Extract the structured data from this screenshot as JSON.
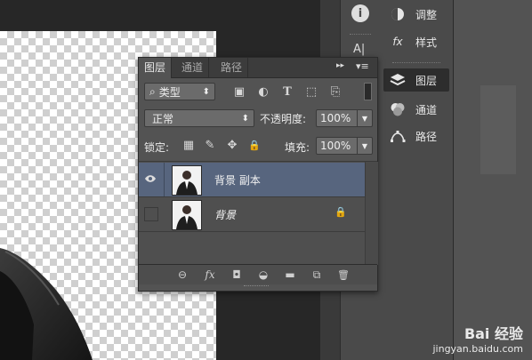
{
  "dock_left": {
    "icons": [
      "info-icon",
      "character-icon"
    ],
    "char_label": "A|"
  },
  "dock": {
    "items": [
      {
        "label": "调整",
        "icon": "adjustments-icon"
      },
      {
        "label": "样式",
        "icon": "styles-icon",
        "glyph": "fx"
      },
      {
        "label": "图层",
        "icon": "layers-icon"
      },
      {
        "label": "通道",
        "icon": "channels-icon"
      },
      {
        "label": "路径",
        "icon": "paths-icon"
      }
    ]
  },
  "layers_panel": {
    "tabs": [
      "图层",
      "通道",
      "路径"
    ],
    "menu_glyphs": {
      "collapse": "▸▸",
      "menu": "▾≡"
    },
    "filter": {
      "icon_glyph": "⌕",
      "label": "类型",
      "arrow": "⬍"
    },
    "filter_icon_glyphs": [
      "▣",
      "◐",
      "T",
      "⬚",
      "⎘"
    ],
    "blend_mode": {
      "value": "正常",
      "arrow": "⬍"
    },
    "opacity": {
      "label": "不透明度:",
      "value": "100%"
    },
    "lock": {
      "label": "锁定:",
      "icon_glyphs": [
        "▦",
        "✎",
        "✥",
        "🔒"
      ]
    },
    "fill": {
      "label": "填充:",
      "value": "100%"
    },
    "layers": [
      {
        "name": "背景 副本",
        "visible": true,
        "selected": true,
        "locked": false
      },
      {
        "name": "背景",
        "visible": false,
        "selected": false,
        "locked": true
      }
    ],
    "footer_icon_glyphs": [
      "⊖",
      "fx",
      "◘",
      "◒",
      "▬",
      "⧉",
      "🗑"
    ]
  },
  "watermark": {
    "logo": "Bai 经验",
    "url": "jingyan.baidu.com"
  }
}
